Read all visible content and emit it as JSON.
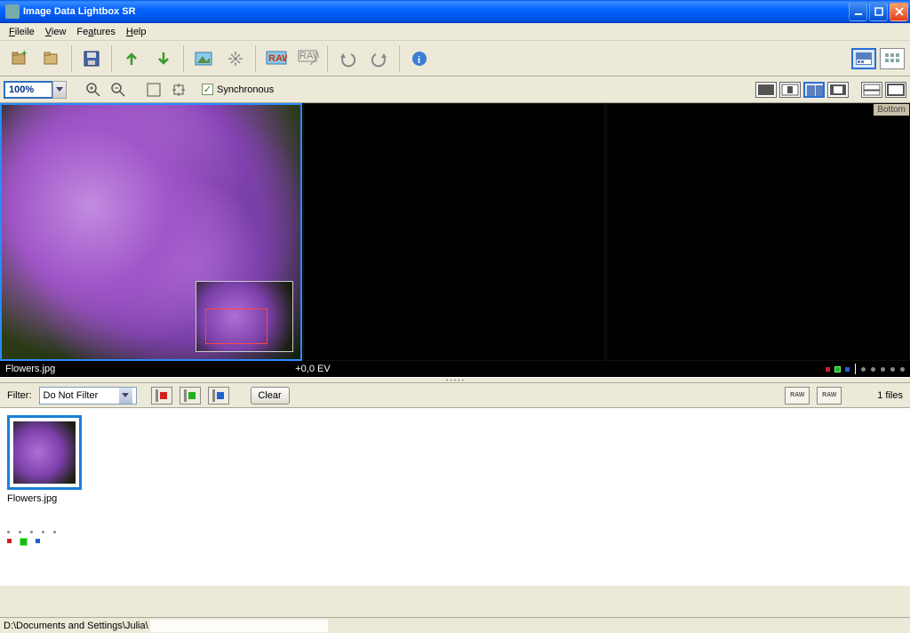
{
  "window": {
    "title": "Image Data Lightbox SR"
  },
  "menu": {
    "file": "File",
    "view": "View",
    "features": "Features",
    "help": "Help"
  },
  "toolbar": {
    "icons": [
      "new-folder",
      "open-folder",
      "save",
      "export",
      "import",
      "image",
      "process",
      "raw",
      "raw-settings",
      "rotate-left",
      "rotate-right",
      "info"
    ]
  },
  "zoom": {
    "value": "100%",
    "synchronous_label": "Synchronous",
    "synchronous_checked": true
  },
  "viewer": {
    "filename": "Flowers.jpg",
    "ev": "+0,0 EV",
    "bottom_tag": "Bottom"
  },
  "filter": {
    "label": "Filter:",
    "selected": "Do Not Filter",
    "clear": "Clear",
    "filecount": "1 files",
    "colors": {
      "red": "#d02020",
      "green": "#20b020",
      "blue": "#2060d0"
    }
  },
  "thumb": {
    "label": "Flowers.jpg"
  },
  "status": {
    "path": "D:\\Documents and Settings\\Julia\\"
  },
  "accent": {
    "blue": "#2a6fd4",
    "titlebar": "#0a5cff"
  }
}
